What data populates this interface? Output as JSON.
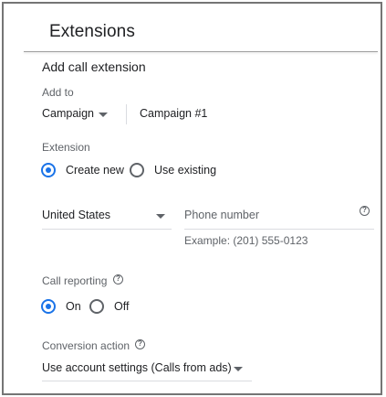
{
  "header": {
    "title": "Extensions"
  },
  "section_title": "Add call extension",
  "add_to": {
    "label": "Add to",
    "level_value": "Campaign",
    "target_value": "Campaign #1"
  },
  "extension": {
    "label": "Extension",
    "options": [
      {
        "label": "Create new",
        "selected": true
      },
      {
        "label": "Use existing",
        "selected": false
      }
    ]
  },
  "phone": {
    "country_value": "United States",
    "number_placeholder": "Phone number",
    "example": "Example: (201) 555-0123",
    "help_icon": "?"
  },
  "call_reporting": {
    "label": "Call reporting",
    "help_icon": "?",
    "options": [
      {
        "label": "On",
        "selected": true
      },
      {
        "label": "Off",
        "selected": false
      }
    ]
  },
  "conversion_action": {
    "label": "Conversion action",
    "help_icon": "?",
    "value": "Use account settings (Calls from ads)"
  },
  "colors": {
    "accent": "#1a73e8",
    "text": "#202124",
    "muted": "#5f6368",
    "divider": "#dadce0"
  }
}
